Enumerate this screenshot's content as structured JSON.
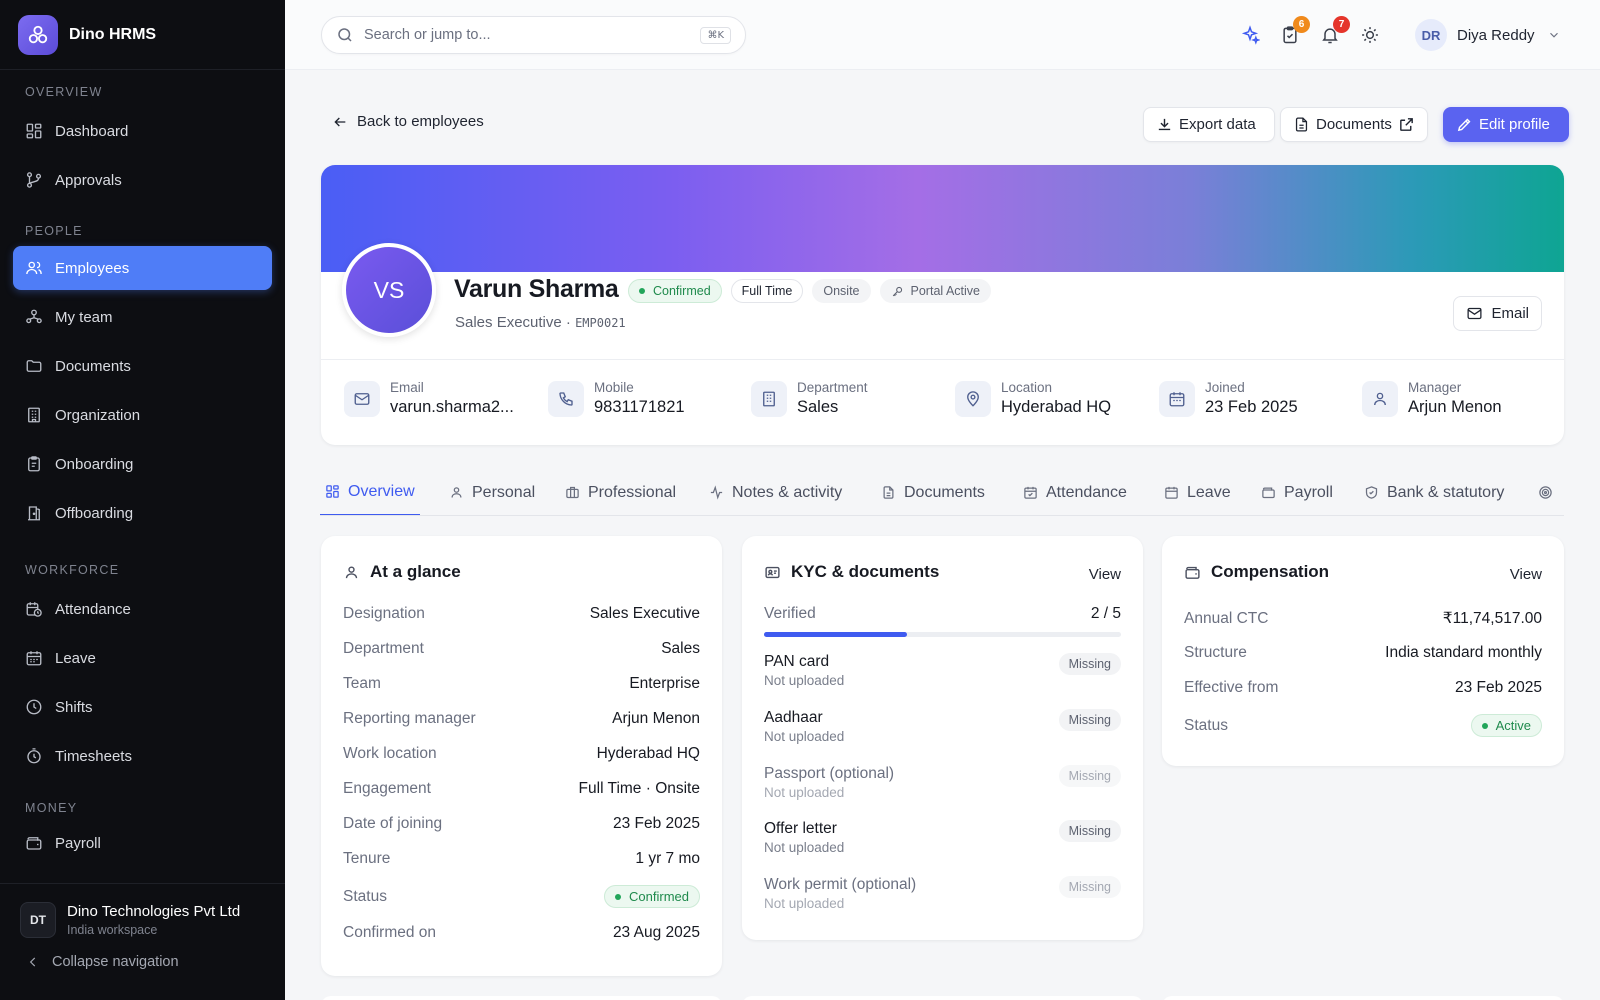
{
  "brand": {
    "name": "Dino HRMS"
  },
  "sidebar": {
    "sections": [
      {
        "heading": "OVERVIEW",
        "items": [
          {
            "label": "Dashboard"
          },
          {
            "label": "Approvals"
          }
        ]
      },
      {
        "heading": "PEOPLE",
        "items": [
          {
            "label": "Employees"
          },
          {
            "label": "My team"
          },
          {
            "label": "Documents"
          },
          {
            "label": "Organization"
          },
          {
            "label": "Onboarding"
          },
          {
            "label": "Offboarding"
          }
        ]
      },
      {
        "heading": "WORKFORCE",
        "items": [
          {
            "label": "Attendance"
          },
          {
            "label": "Leave"
          },
          {
            "label": "Shifts"
          },
          {
            "label": "Timesheets"
          }
        ]
      },
      {
        "heading": "MONEY",
        "items": [
          {
            "label": "Payroll"
          }
        ]
      }
    ],
    "footer": {
      "org_initials": "DT",
      "org_name": "Dino Technologies Pvt Ltd",
      "org_sub": "India workspace",
      "collapse_label": "Collapse navigation"
    }
  },
  "topbar": {
    "search_placeholder": "Search or jump to...",
    "search_shortcut": "⌘K",
    "tasks_badge": "6",
    "notifications_badge": "7",
    "user_initials": "DR",
    "user_name": "Diya Reddy"
  },
  "actions": {
    "back_label": "Back to employees",
    "export_label": "Export data",
    "documents_label": "Documents",
    "edit_label": "Edit profile"
  },
  "profile": {
    "initials": "VS",
    "name": "Varun Sharma",
    "chips": {
      "status": "Confirmed",
      "type": "Full Time",
      "mode": "Onsite",
      "portal": "Portal Active"
    },
    "designation": "Sales Executive",
    "separator": "·",
    "emp_code": "EMP0021",
    "email_button": "Email",
    "info": [
      {
        "label": "Email",
        "value": "varun.sharma2..."
      },
      {
        "label": "Mobile",
        "value": "9831171821"
      },
      {
        "label": "Department",
        "value": "Sales"
      },
      {
        "label": "Location",
        "value": "Hyderabad HQ"
      },
      {
        "label": "Joined",
        "value": "23 Feb 2025"
      },
      {
        "label": "Manager",
        "value": "Arjun Menon"
      }
    ]
  },
  "tabs": [
    {
      "label": "Overview"
    },
    {
      "label": "Personal"
    },
    {
      "label": "Professional"
    },
    {
      "label": "Notes & activity"
    },
    {
      "label": "Documents"
    },
    {
      "label": "Attendance"
    },
    {
      "label": "Leave"
    },
    {
      "label": "Payroll"
    },
    {
      "label": "Bank & statutory"
    }
  ],
  "glance": {
    "title": "At a glance",
    "rows": [
      {
        "k": "Designation",
        "v": "Sales Executive"
      },
      {
        "k": "Department",
        "v": "Sales"
      },
      {
        "k": "Team",
        "v": "Enterprise"
      },
      {
        "k": "Reporting manager",
        "v": "Arjun Menon"
      },
      {
        "k": "Work location",
        "v": "Hyderabad HQ"
      },
      {
        "k": "Engagement",
        "v": "Full Time · Onsite"
      },
      {
        "k": "Date of joining",
        "v": "23 Feb 2025"
      },
      {
        "k": "Tenure",
        "v": "1 yr 7 mo"
      },
      {
        "k": "Status",
        "v": "Confirmed"
      },
      {
        "k": "Confirmed on",
        "v": "23 Aug 2025"
      }
    ]
  },
  "kyc": {
    "title": "KYC & documents",
    "view_label": "View",
    "verified_label": "Verified",
    "verified_count": "2 / 5",
    "verified_fraction": 0.4,
    "docs": [
      {
        "name": "PAN card",
        "status": "Not uploaded",
        "badge": "Missing"
      },
      {
        "name": "Aadhaar",
        "status": "Not uploaded",
        "badge": "Missing"
      },
      {
        "name": "Passport (optional)",
        "status": "Not uploaded",
        "badge": "Missing"
      },
      {
        "name": "Offer letter",
        "status": "Not uploaded",
        "badge": "Missing"
      },
      {
        "name": "Work permit (optional)",
        "status": "Not uploaded",
        "badge": "Missing"
      }
    ]
  },
  "compensation": {
    "title": "Compensation",
    "view_label": "View",
    "rows": [
      {
        "k": "Annual CTC",
        "v": "₹11,74,517.00"
      },
      {
        "k": "Structure",
        "v": "India standard monthly"
      },
      {
        "k": "Effective from",
        "v": "23 Feb 2025"
      },
      {
        "k": "Status",
        "v": "Active"
      }
    ]
  },
  "colors": {
    "accent": "#3f5bf0",
    "nav_active": "#4f7df7",
    "primary_button": "#5a63f0",
    "success": "#22a55a",
    "badge_orange": "#f08a1c",
    "badge_red": "#e5352b"
  }
}
